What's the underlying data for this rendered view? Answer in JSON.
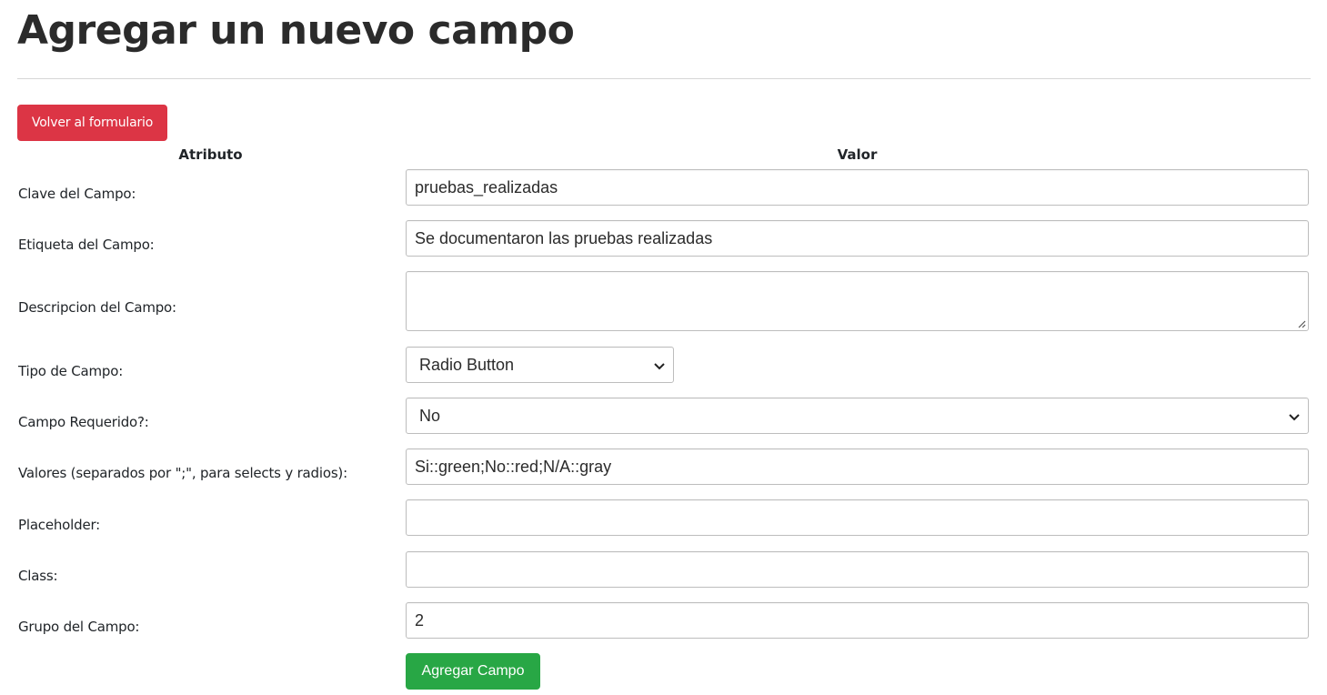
{
  "page_title": "Agregar un nuevo campo",
  "back_button_label": "Volver al formulario",
  "headers": {
    "attribute": "Atributo",
    "value": "Valor"
  },
  "fields": {
    "clave": {
      "label": "Clave del Campo:",
      "value": "pruebas_realizadas"
    },
    "etiqueta": {
      "label": "Etiqueta del Campo:",
      "value": "Se documentaron las pruebas realizadas"
    },
    "descripcion": {
      "label": "Descripcion del Campo:",
      "value": ""
    },
    "tipo": {
      "label": "Tipo de Campo:",
      "selected": "Radio Button"
    },
    "requerido": {
      "label": "Campo Requerido?:",
      "selected": "No"
    },
    "valores": {
      "label": "Valores (separados por \";\", para selects y radios):",
      "value": "Si::green;No::red;N/A::gray"
    },
    "placeholder": {
      "label": "Placeholder:",
      "value": ""
    },
    "class": {
      "label": "Class:",
      "value": ""
    },
    "grupo": {
      "label": "Grupo del Campo:",
      "value": "2"
    }
  },
  "submit_label": "Agregar Campo",
  "colors": {
    "back_button": "#dc3545",
    "submit_button": "#28a745"
  },
  "icons": {
    "select_arrow": "chevron-down-icon",
    "textarea_grip": "resize-grip-icon"
  }
}
